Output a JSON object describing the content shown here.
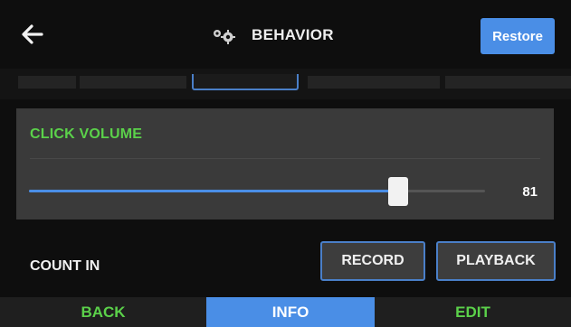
{
  "header": {
    "title": "BEHAVIOR",
    "restore_label": "Restore",
    "back_icon": "arrow-left-icon",
    "title_icon": "gears-icon"
  },
  "tabs": [
    {
      "label": "",
      "active": false
    },
    {
      "label": "",
      "active": false
    },
    {
      "label": "",
      "active": true
    },
    {
      "label": "",
      "active": false
    },
    {
      "label": "",
      "active": false
    }
  ],
  "click_volume": {
    "label": "CLICK VOLUME",
    "value": 81,
    "value_text": "81",
    "max": 100
  },
  "count_in": {
    "label": "COUNT IN",
    "record_label": "RECORD",
    "playback_label": "PLAYBACK"
  },
  "navbar": {
    "back_label": "BACK",
    "info_label": "INFO",
    "edit_label": "EDIT"
  },
  "colors": {
    "accent_blue": "#4a8ee6",
    "label_green": "#5bd14a",
    "panel_gray": "#3a3a3a",
    "background": "#0e0e0e"
  }
}
